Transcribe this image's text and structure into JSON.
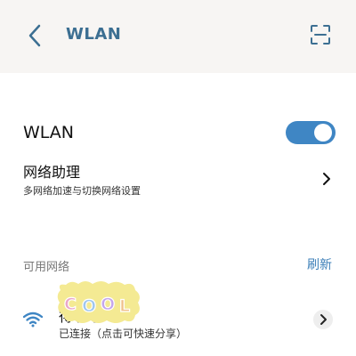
{
  "header": {
    "title": "WLAN",
    "back_icon": "chevron-left-icon",
    "scan_icon": "scan-frame-icon"
  },
  "wlan": {
    "label": "WLAN",
    "enabled": true,
    "accent_color": "#3f86c4"
  },
  "assistant": {
    "title": "网络助理",
    "subtitle": "多网络加速与切换网络设置"
  },
  "available": {
    "section_title": "可用网络",
    "refresh_label": "刷新",
    "networks": [
      {
        "name": "得ヶ号",
        "status": "已连接（点击可快速分享）",
        "icon": "wifi-connected-icon"
      }
    ]
  },
  "overlay": {
    "sticker_text": "COOL"
  },
  "colors": {
    "accent": "#3f86c4",
    "title": "#3c6f92",
    "header_bg": "#f7f5f3"
  }
}
